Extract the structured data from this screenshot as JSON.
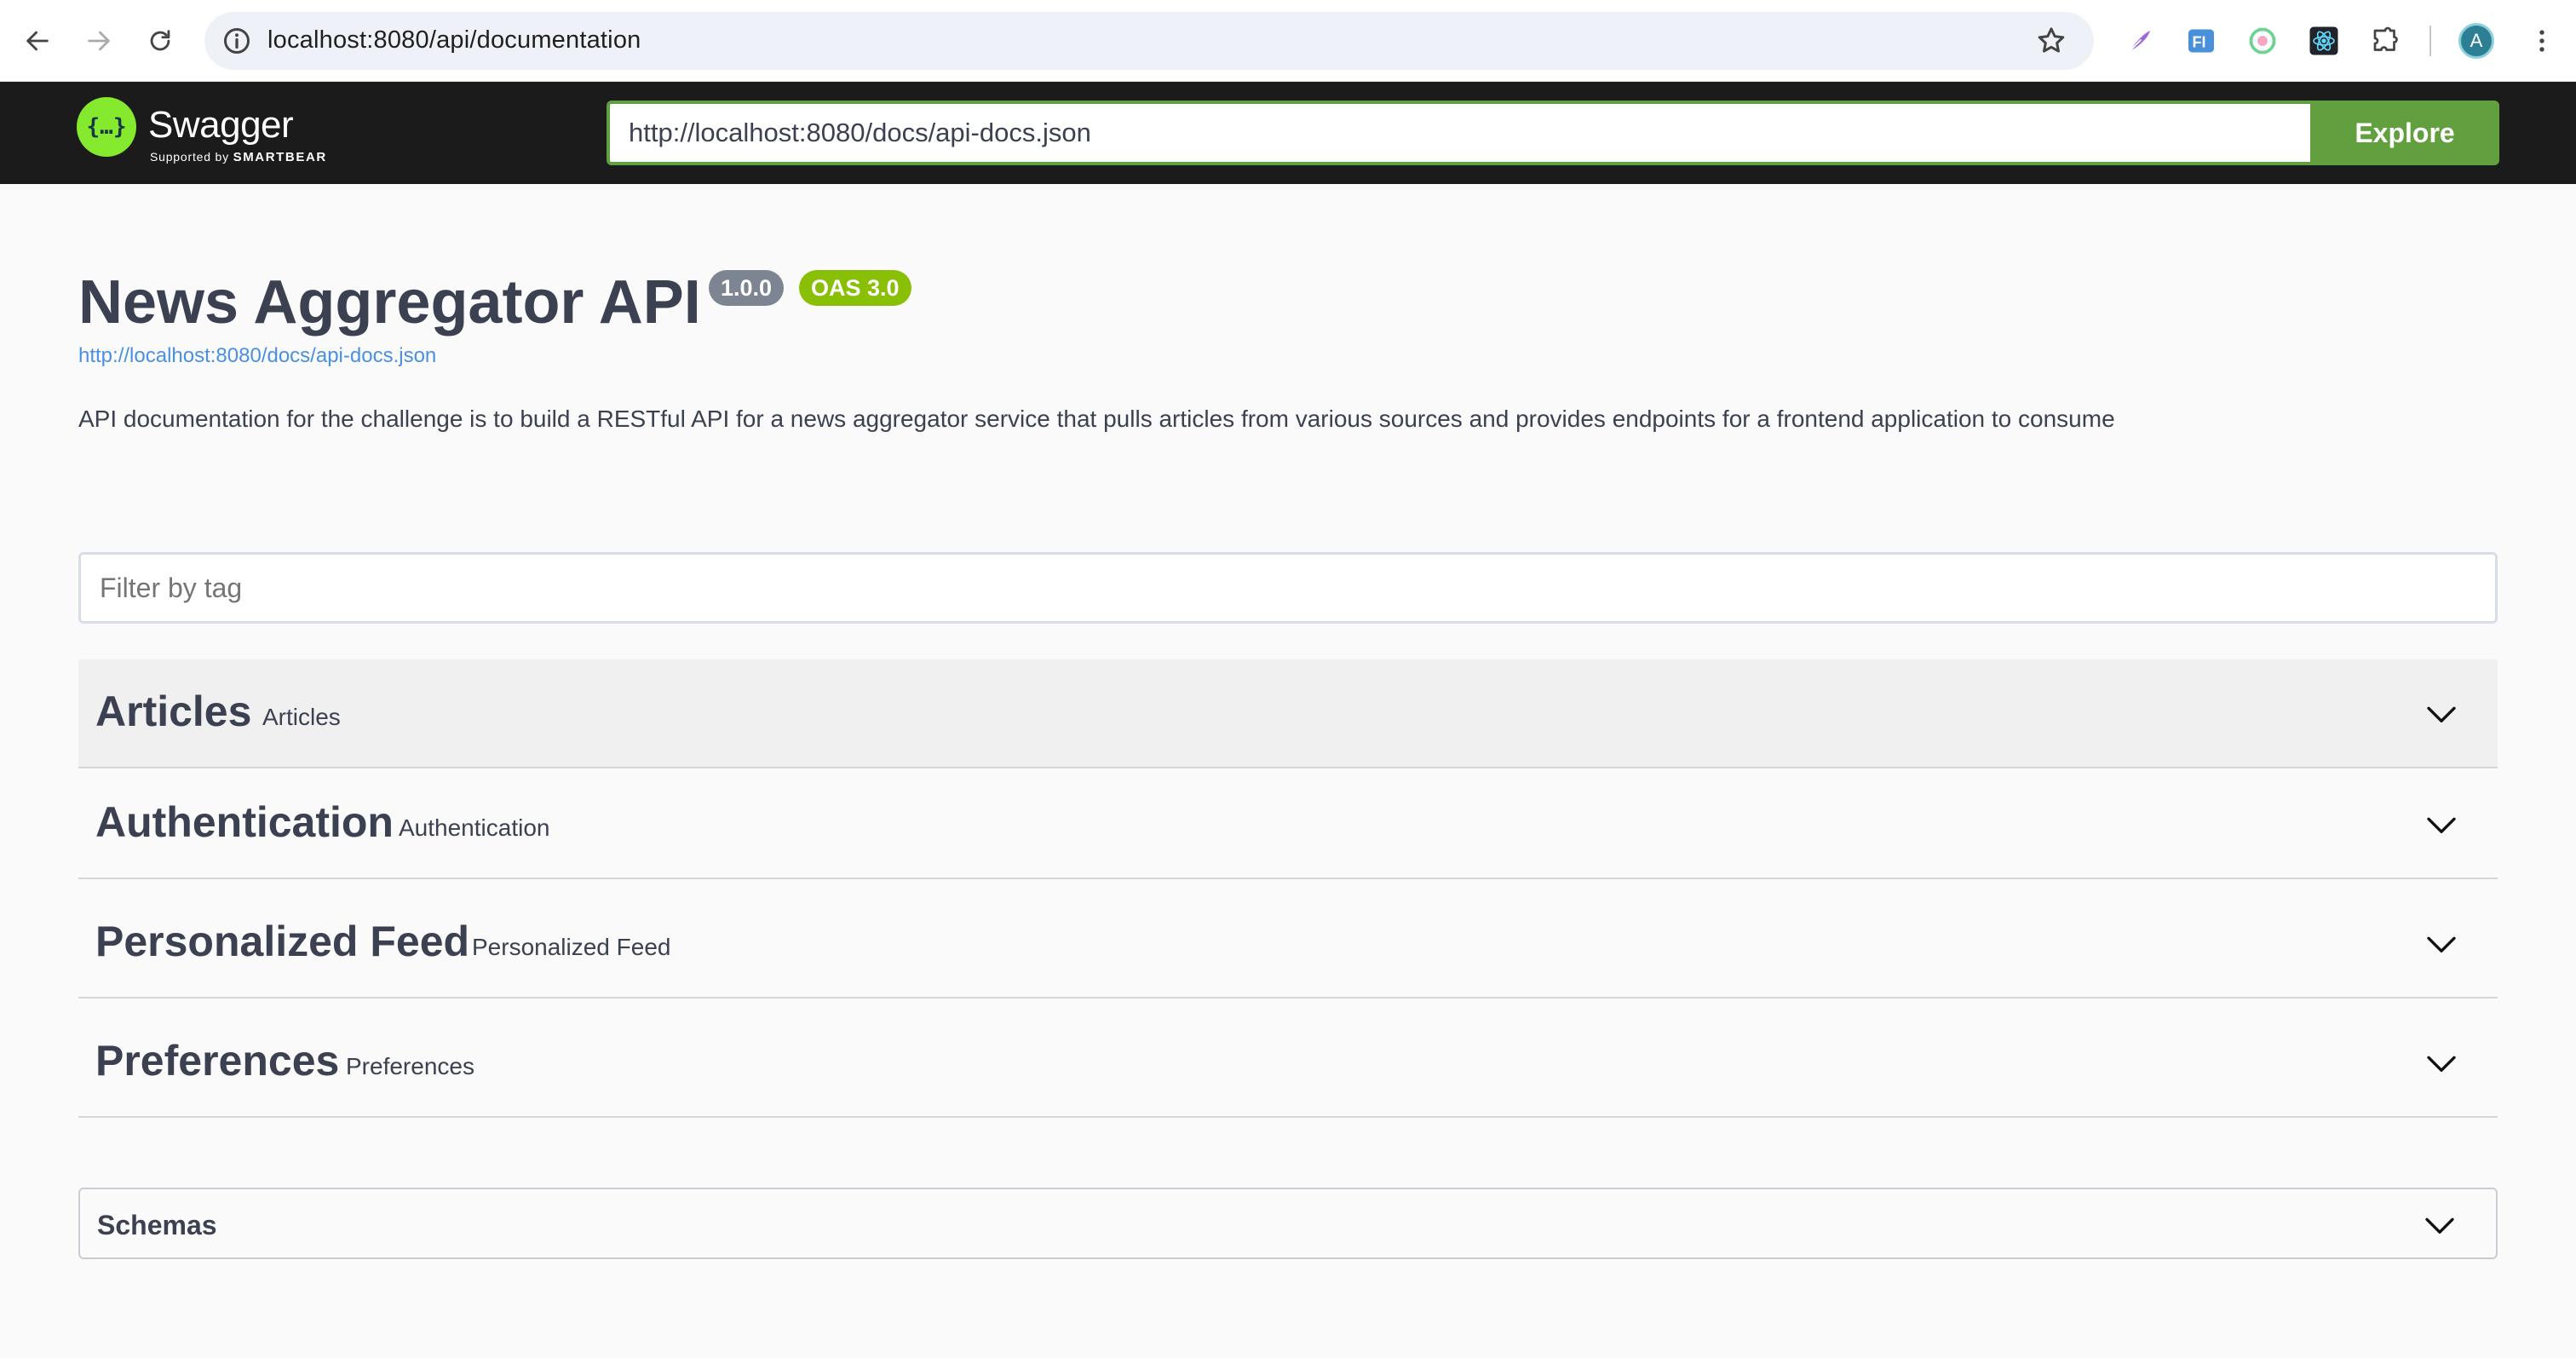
{
  "browser": {
    "url": "localhost:8080/api/documentation",
    "avatar_initial": "A"
  },
  "topbar": {
    "logo_name": "Swagger",
    "logo_sub_prefix": "Supported by",
    "logo_sub_brand": "SMARTBEAR",
    "spec_url_value": "http://localhost:8080/docs/api-docs.json",
    "explore_label": "Explore"
  },
  "info": {
    "title": "News Aggregator API",
    "version": "1.0.0",
    "oas": "OAS 3.0",
    "spec_link": "http://localhost:8080/docs/api-docs.json",
    "description": "API documentation for the challenge is to build a RESTful API for a news aggregator service that pulls articles from various sources and provides endpoints for a frontend application to consume"
  },
  "filter": {
    "placeholder": "Filter by tag"
  },
  "tags": [
    {
      "name": "Articles",
      "description": "Articles"
    },
    {
      "name": "Authentication",
      "description": "Authentication"
    },
    {
      "name": "Personalized Feed",
      "description": "Personalized Feed"
    },
    {
      "name": "Preferences",
      "description": "Preferences"
    }
  ],
  "schemas": {
    "title": "Schemas"
  },
  "colors": {
    "topbar_bg": "#1b1b1b",
    "accent_green": "#62a03f",
    "oas_badge": "#89bf04",
    "version_badge": "#7d8492",
    "link": "#4990e2"
  }
}
